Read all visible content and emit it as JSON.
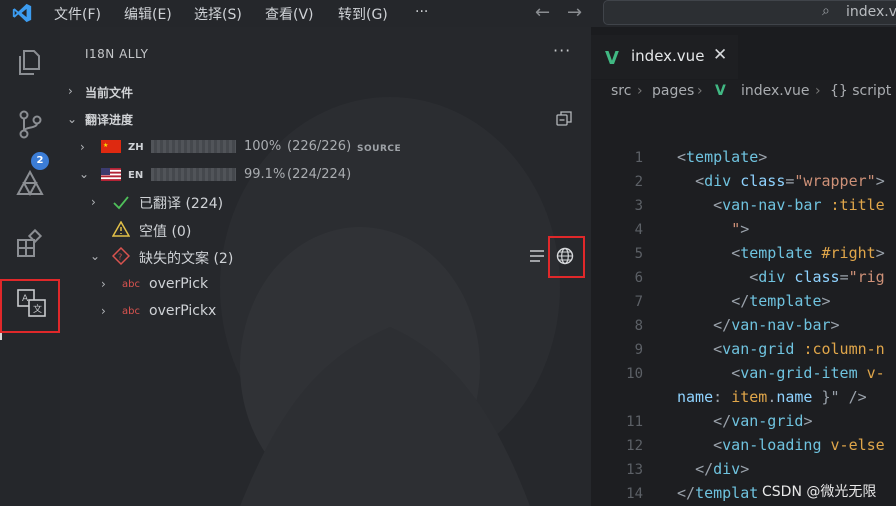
{
  "titlebar": {
    "menus": [
      "文件(F)",
      "编辑(E)",
      "选择(S)",
      "查看(V)",
      "转到(G)",
      "···"
    ],
    "search_text": "index.vue",
    "accent": "#3c9cf0"
  },
  "activitybar": {
    "icons": [
      "files-icon",
      "source-control-icon",
      "extensions-icon-2",
      "extensions-icon",
      "i18n-ally-icon"
    ],
    "scm_badge": "2"
  },
  "sidebar": {
    "title": "I18N ALLY",
    "more": "···",
    "section_current": "当前文件",
    "section_progress": "翻译进度",
    "zh": {
      "code": "ZH",
      "percent": "100%",
      "count": "(226/226)",
      "tag": "SOURCE"
    },
    "en": {
      "code": "EN",
      "percent": "99.1%",
      "count": "(224/224)"
    },
    "translated": "已翻译 (224)",
    "empty": "空值 (0)",
    "missing": "缺失的文案 (2)",
    "missing_items": [
      "overPick",
      "overPickx"
    ],
    "abc": "abc"
  },
  "editor": {
    "tab_label": "index.vue",
    "breadcrumb": [
      "src",
      "pages",
      "index.vue",
      "{} script"
    ],
    "line_numbers": [
      "1",
      "2",
      "3",
      "4",
      "5",
      "6",
      "7",
      "8",
      "9",
      "10",
      "11",
      "12",
      "13",
      "14"
    ]
  },
  "watermark": "CSDN @微光无限"
}
